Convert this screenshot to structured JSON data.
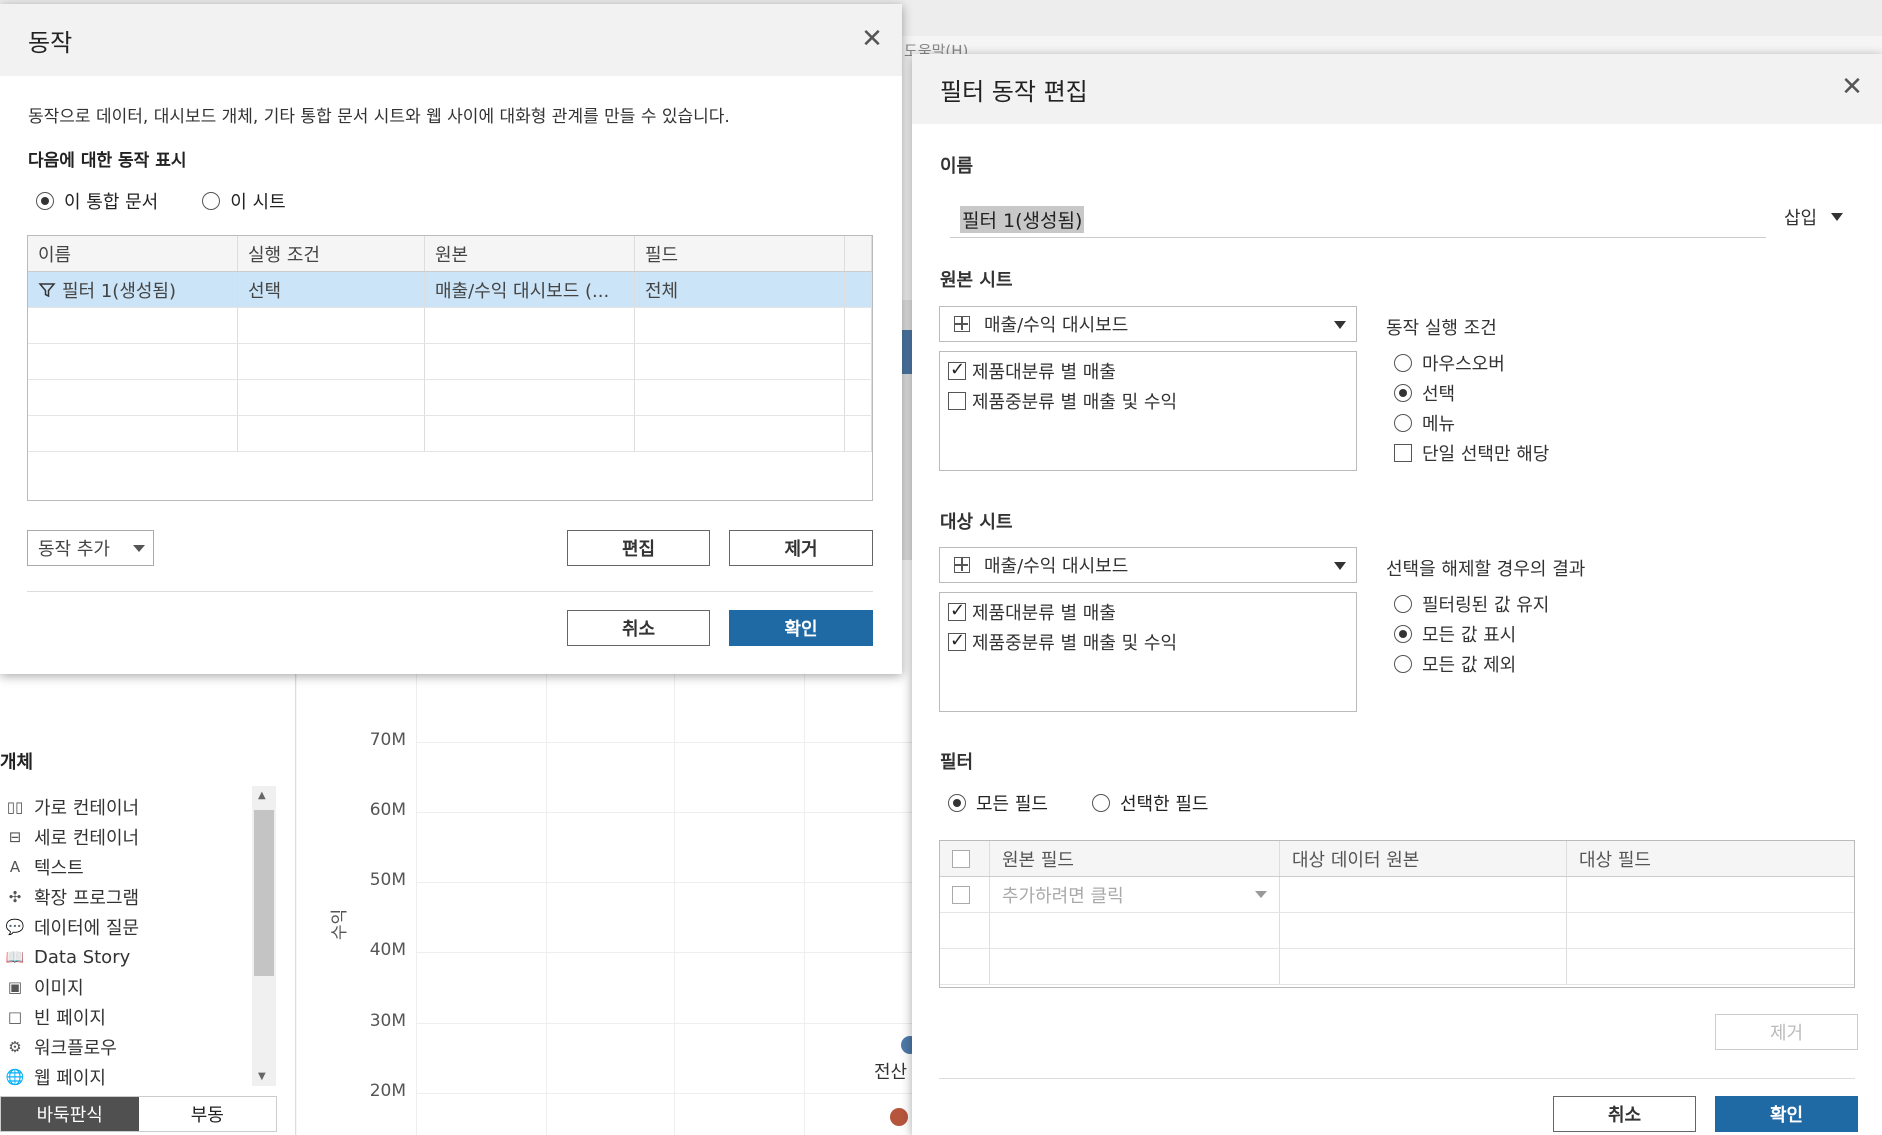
{
  "background": {
    "menu_help": "도움말(H)",
    "objects_title": "개체",
    "objects": [
      {
        "icon": "horizontal-container-icon",
        "glyph": "▯▯",
        "label": "가로 컨테이너"
      },
      {
        "icon": "vertical-container-icon",
        "glyph": "⊟",
        "label": "세로 컨테이너"
      },
      {
        "icon": "text-icon",
        "glyph": "A",
        "label": "텍스트"
      },
      {
        "icon": "extension-icon",
        "glyph": "✣",
        "label": "확장 프로그램"
      },
      {
        "icon": "ask-data-icon",
        "glyph": "💬",
        "label": "데이터에 질문"
      },
      {
        "icon": "data-story-icon",
        "glyph": "📖",
        "label": "Data Story"
      },
      {
        "icon": "image-icon",
        "glyph": "▣",
        "label": "이미지"
      },
      {
        "icon": "blank-icon",
        "glyph": "□",
        "label": "빈 페이지"
      },
      {
        "icon": "workflow-icon",
        "glyph": "⚙",
        "label": "워크플로우"
      },
      {
        "icon": "web-page-icon",
        "glyph": "🌐",
        "label": "웹 페이지"
      }
    ],
    "layout_tabs": [
      "바둑판식",
      "부동"
    ],
    "chart": {
      "y_axis_label": "수익",
      "ticks": [
        "70M",
        "60M",
        "50M",
        "40M",
        "30M",
        "20M"
      ],
      "point_labels": [
        "전산"
      ],
      "colors": {
        "blue": "#4e79a7",
        "red": "#b5553c"
      }
    }
  },
  "actions_dialog": {
    "title": "동작",
    "description": "동작으로 데이터, 대시보드 개체, 기타 통합 문서 시트와 웹 사이에 대화형 관계를 만들 수 있습니다.",
    "show_for_label": "다음에 대한 동작 표시",
    "scope_options": [
      {
        "label": "이 통합 문서",
        "selected": true
      },
      {
        "label": "이 시트",
        "selected": false
      }
    ],
    "table": {
      "columns": [
        "이름",
        "실행 조건",
        "원본",
        "필드"
      ],
      "rows": [
        {
          "name": "필터 1(생성됨)",
          "run_on": "선택",
          "source": "매출/수익 대시보드 (...",
          "fields": "전체"
        }
      ]
    },
    "add_action": "동작 추가",
    "edit": "편집",
    "remove": "제거",
    "cancel": "취소",
    "ok": "확인"
  },
  "filter_dialog": {
    "title": "필터 동작 편집",
    "name_label": "이름",
    "name_value": "필터 1(생성됨)",
    "insert": "삽입",
    "source_label": "원본 시트",
    "source_dropdown": "매출/수익 대시보드",
    "source_sheets": [
      {
        "label": "제품대분류 별 매출",
        "checked": true
      },
      {
        "label": "제품중분류 별 매출 및 수익",
        "checked": false
      }
    ],
    "run_on_label": "동작 실행 조건",
    "run_on_options": [
      {
        "label": "마우스오버",
        "selected": false
      },
      {
        "label": "선택",
        "selected": true
      },
      {
        "label": "메뉴",
        "selected": false
      }
    ],
    "single_select": "단일 선택만 해당",
    "target_label": "대상 시트",
    "target_dropdown": "매출/수익 대시보드",
    "target_sheets": [
      {
        "label": "제품대분류 별 매출",
        "checked": true
      },
      {
        "label": "제품중분류 별 매출 및 수익",
        "checked": true
      }
    ],
    "clear_label": "선택을 해제할 경우의 결과",
    "clear_options": [
      {
        "label": "필터링된 값 유지",
        "selected": false
      },
      {
        "label": "모든 값 표시",
        "selected": true
      },
      {
        "label": "모든 값 제외",
        "selected": false
      }
    ],
    "filter_label": "필터",
    "filter_options": [
      {
        "label": "모든 필드",
        "selected": true
      },
      {
        "label": "선택한 필드",
        "selected": false
      }
    ],
    "field_table": {
      "columns": [
        "원본 필드",
        "대상 데이터 원본",
        "대상 필드"
      ],
      "placeholder": "추가하려면 클릭"
    },
    "remove": "제거",
    "cancel": "취소",
    "ok": "확인"
  }
}
